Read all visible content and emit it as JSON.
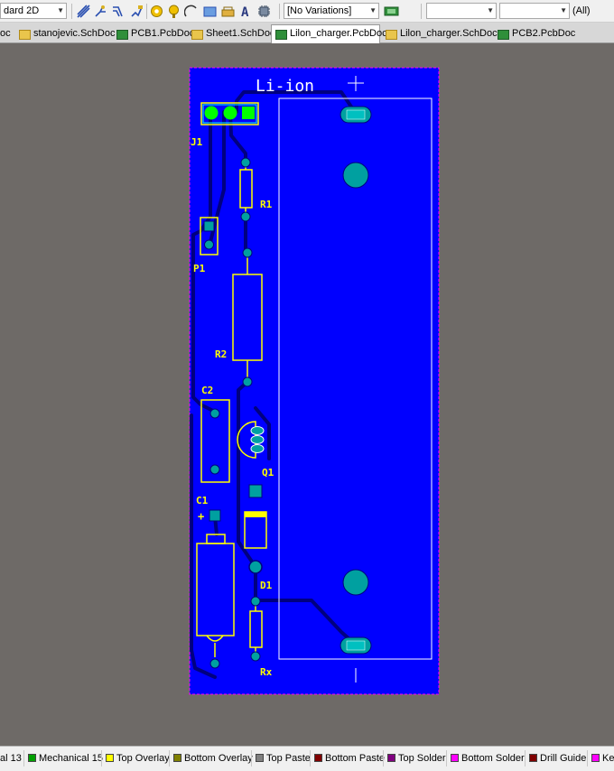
{
  "toolbar": {
    "view_mode": "dard 2D",
    "variations": "[No Variations]",
    "filter_combo_1": "",
    "filter_combo_2": "",
    "filter_all": "(All)"
  },
  "tabs": [
    {
      "label": "oc",
      "type": "pcb",
      "active": false
    },
    {
      "label": "stanojevic.SchDoc",
      "type": "sch",
      "active": false
    },
    {
      "label": "PCB1.PcbDoc",
      "type": "pcb",
      "active": false
    },
    {
      "label": "Sheet1.SchDoc",
      "type": "sch",
      "active": false
    },
    {
      "label": "Lilon_charger.PcbDoc",
      "type": "pcb",
      "active": true
    },
    {
      "label": "Lilon_charger.SchDoc",
      "type": "sch",
      "active": false
    },
    {
      "label": "PCB2.PcbDoc",
      "type": "pcb",
      "active": false
    }
  ],
  "board": {
    "title": "Li-ion",
    "designators": {
      "j1": "J1",
      "r1": "R1",
      "p1": "P1",
      "r2": "R2",
      "c2": "C2",
      "q1": "Q1",
      "c1": "C1",
      "d1": "D1",
      "rx": "Rx",
      "plus": "+"
    },
    "colors": {
      "board": "#0000ff",
      "overlay": "#ffff00",
      "pad": "#00a0a0",
      "trace": "#000080",
      "keepout": "#ff00ff",
      "mechanical": "#ffffff",
      "j1_pad": "#00ff00"
    }
  },
  "layers": [
    {
      "label": "al 13",
      "color": null
    },
    {
      "label": "Mechanical 15",
      "color": "#00a000"
    },
    {
      "label": "Top Overlay",
      "color": "#ffff00"
    },
    {
      "label": "Bottom Overlay",
      "color": "#808000"
    },
    {
      "label": "Top Paste",
      "color": "#808080"
    },
    {
      "label": "Bottom Paste",
      "color": "#800000"
    },
    {
      "label": "Top Solder",
      "color": "#800080"
    },
    {
      "label": "Bottom Solder",
      "color": "#ff00ff"
    },
    {
      "label": "Drill Guide",
      "color": "#800000"
    },
    {
      "label": "Ke",
      "color": "#ff00ff"
    }
  ]
}
